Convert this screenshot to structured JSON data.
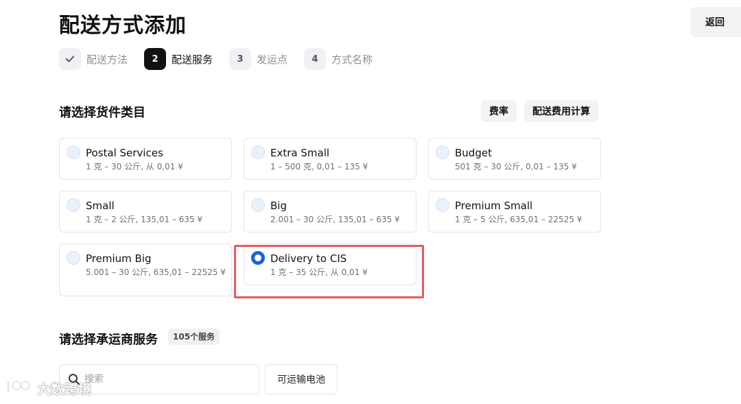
{
  "header": {
    "title": "配送方式添加",
    "back_label": "返回"
  },
  "steps": [
    {
      "badge": "",
      "label": "配送方法",
      "state": "done"
    },
    {
      "badge": "2",
      "label": "配送服务",
      "state": "active"
    },
    {
      "badge": "3",
      "label": "发运点",
      "state": "pending"
    },
    {
      "badge": "4",
      "label": "方式名称",
      "state": "pending"
    }
  ],
  "category_section": {
    "title": "请选择货件类目",
    "rate_button": "费率",
    "calc_button": "配送费用计算",
    "cards": [
      {
        "name": "Postal Services",
        "desc": "1 克 – 30 公斤, 从 0,01 ¥",
        "selected": false
      },
      {
        "name": "Extra Small",
        "desc": "1 – 500 克, 0,01 – 135 ¥",
        "selected": false
      },
      {
        "name": "Budget",
        "desc": "501 克 – 30 公斤, 0,01 – 135 ¥",
        "selected": false
      },
      {
        "name": "Small",
        "desc": "1 克 – 2 公斤, 135,01 – 635 ¥",
        "selected": false
      },
      {
        "name": "Big",
        "desc": "2.001 – 30 公斤, 135,01 – 635 ¥",
        "selected": false
      },
      {
        "name": "Premium Small",
        "desc": "1 克 – 5 公斤, 635,01 – 22525 ¥",
        "selected": false
      },
      {
        "name": "Premium Big",
        "desc": "5.001 – 30 公斤, 635,01 – 22525 ¥",
        "selected": false
      },
      {
        "name": "Delivery to CIS",
        "desc": "1 克 – 35 公斤, 从 0,01 ¥",
        "selected": true
      }
    ]
  },
  "carrier_section": {
    "title": "请选择承运商服务",
    "count_badge": "105个服务",
    "search_placeholder": "搜索",
    "battery_button": "可运输电池"
  },
  "watermark": {
    "text": "大数跨境"
  },
  "colors": {
    "accent": "#1564e0",
    "highlight": "#e85a5a",
    "step_active": "#111111"
  }
}
